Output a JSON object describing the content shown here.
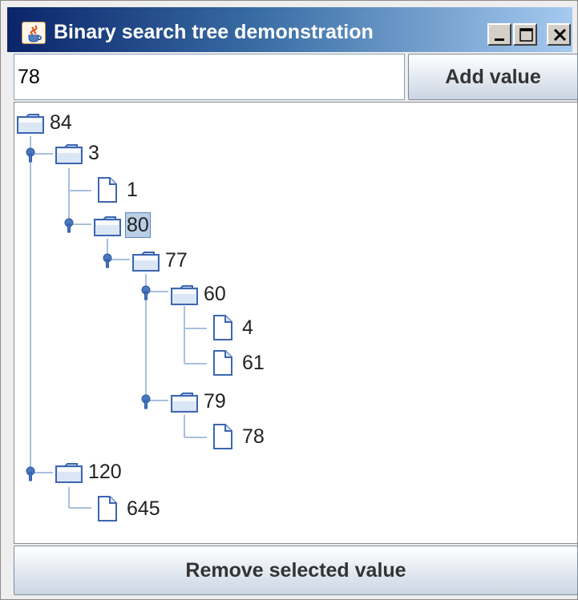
{
  "window": {
    "title": "Binary search tree demonstration",
    "controls": [
      "minimize-icon",
      "maximize-icon",
      "close-icon"
    ],
    "title_gradient": [
      "#0a246a",
      "#a6caf0"
    ]
  },
  "input": {
    "value": "78"
  },
  "buttons": {
    "add_label": "Add value",
    "remove_label": "Remove selected value"
  },
  "tree": {
    "selected": "80",
    "nodes": [
      {
        "label": "84",
        "type": "folder",
        "depth": 0
      },
      {
        "label": "3",
        "type": "folder",
        "depth": 1
      },
      {
        "label": "1",
        "type": "leaf",
        "depth": 2
      },
      {
        "label": "80",
        "type": "folder",
        "depth": 2
      },
      {
        "label": "77",
        "type": "folder",
        "depth": 3
      },
      {
        "label": "60",
        "type": "folder",
        "depth": 4
      },
      {
        "label": "4",
        "type": "leaf",
        "depth": 5
      },
      {
        "label": "61",
        "type": "leaf",
        "depth": 5
      },
      {
        "label": "79",
        "type": "folder",
        "depth": 4
      },
      {
        "label": "78",
        "type": "leaf",
        "depth": 5
      },
      {
        "label": "120",
        "type": "folder",
        "depth": 1
      },
      {
        "label": "645",
        "type": "leaf",
        "depth": 2
      }
    ]
  },
  "colors": {
    "selection": "#b8cfe5",
    "tree_lines": "#a8c0dc",
    "icon_blue": "#4a78c0"
  }
}
